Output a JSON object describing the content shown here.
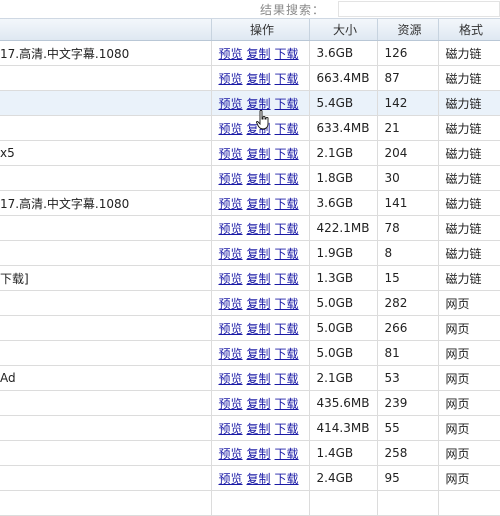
{
  "search": {
    "label": "结果搜索："
  },
  "columns": {
    "op": "操作",
    "size": "大小",
    "sources": "资源",
    "format": "格式"
  },
  "ops": {
    "preview": "预览",
    "copy": "复制",
    "download": "下载"
  },
  "rows": [
    {
      "name": "17.高清.中文字幕.1080",
      "size": "3.6GB",
      "sources": "126",
      "format": "磁力链"
    },
    {
      "name": "",
      "size": "663.4MB",
      "sources": "87",
      "format": "磁力链"
    },
    {
      "name": "",
      "size": "5.4GB",
      "sources": "142",
      "format": "磁力链"
    },
    {
      "name": "",
      "size": "633.4MB",
      "sources": "21",
      "format": "磁力链"
    },
    {
      "name": "x5",
      "size": "2.1GB",
      "sources": "204",
      "format": "磁力链"
    },
    {
      "name": "",
      "size": "1.8GB",
      "sources": "30",
      "format": "磁力链"
    },
    {
      "name": "17.高清.中文字幕.1080",
      "size": "3.6GB",
      "sources": "141",
      "format": "磁力链"
    },
    {
      "name": "",
      "size": "422.1MB",
      "sources": "78",
      "format": "磁力链"
    },
    {
      "name": "",
      "size": "1.9GB",
      "sources": "8",
      "format": "磁力链"
    },
    {
      "name": "下载]",
      "size": "1.3GB",
      "sources": "15",
      "format": "磁力链"
    },
    {
      "name": "",
      "size": "5.0GB",
      "sources": "282",
      "format": "网页"
    },
    {
      "name": "",
      "size": "5.0GB",
      "sources": "266",
      "format": "网页"
    },
    {
      "name": "",
      "size": "5.0GB",
      "sources": "81",
      "format": "网页"
    },
    {
      "name": "Ad",
      "size": "2.1GB",
      "sources": "53",
      "format": "网页"
    },
    {
      "name": "",
      "size": "435.6MB",
      "sources": "239",
      "format": "网页"
    },
    {
      "name": "",
      "size": "414.3MB",
      "sources": "55",
      "format": "网页"
    },
    {
      "name": "",
      "size": "1.4GB",
      "sources": "258",
      "format": "网页"
    },
    {
      "name": "",
      "size": "2.4GB",
      "sources": "95",
      "format": "网页"
    },
    {
      "name": "",
      "size": "",
      "sources": "",
      "format": ""
    }
  ]
}
